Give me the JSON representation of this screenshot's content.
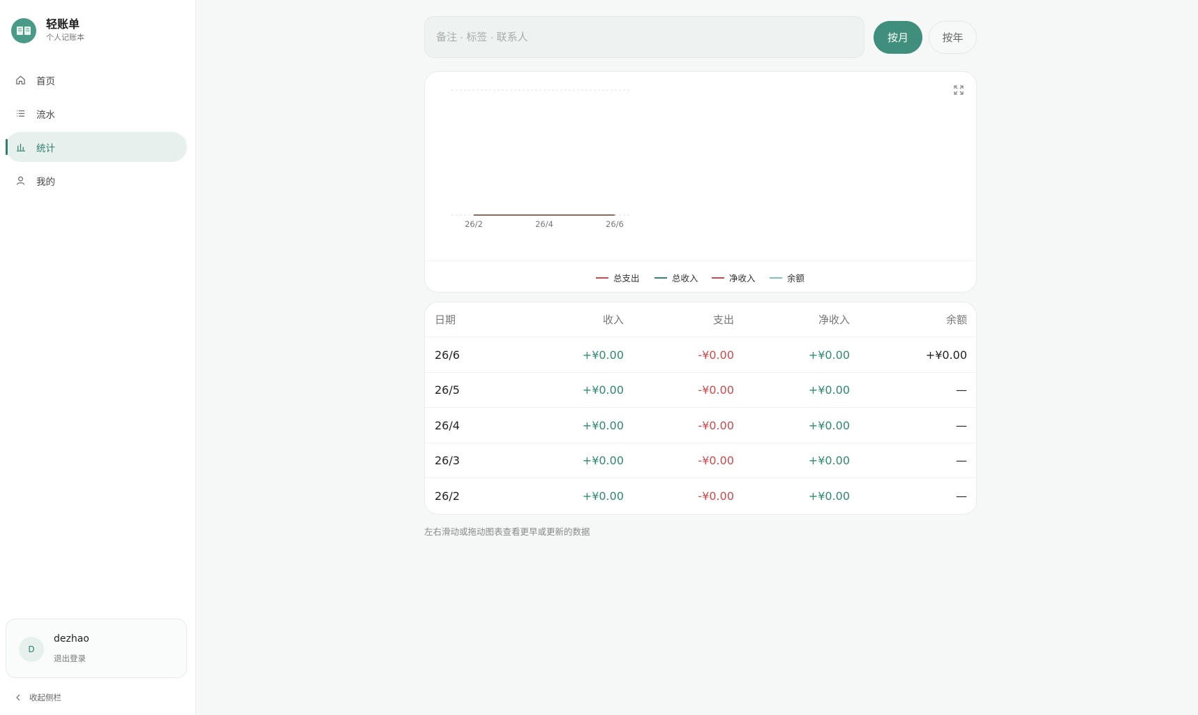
{
  "brand": {
    "title": "轻账单",
    "subtitle": "个人记账本",
    "logo_icon": "book-icon"
  },
  "nav": {
    "items": [
      {
        "label": "首页",
        "icon": "home-icon"
      },
      {
        "label": "流水",
        "icon": "list-icon"
      },
      {
        "label": "统计",
        "icon": "bar-chart-icon",
        "active": true
      },
      {
        "label": "我的",
        "icon": "user-icon"
      }
    ]
  },
  "user": {
    "avatar_letter": "D",
    "name": "dezhao",
    "logout": "退出登录"
  },
  "sidebar_footer": {
    "collapse": "收起侧栏"
  },
  "search": {
    "placeholder": "备注 · 标签 · 联系人",
    "value": ""
  },
  "period": {
    "month_label": "按月",
    "year_label": "按年",
    "selected": "按月"
  },
  "colors": {
    "accent": "#3f8f7c",
    "income": "#2f8a70",
    "expense": "#d4474a",
    "balance_line": "#7fc3ad"
  },
  "chart_data": {
    "type": "line",
    "x": [
      "26/2",
      "26/3",
      "26/4",
      "26/5",
      "26/6"
    ],
    "x_tick_labels": [
      "26/2",
      "26/4",
      "26/6"
    ],
    "series": [
      {
        "name": "总支出",
        "values": [
          0,
          0,
          0,
          0,
          0
        ],
        "color": "#d4474a"
      },
      {
        "name": "总收入",
        "values": [
          0,
          0,
          0,
          0,
          0
        ],
        "color": "#2f8a70"
      },
      {
        "name": "净收入",
        "values": [
          0,
          0,
          0,
          0,
          0
        ],
        "color": "#d4474a"
      },
      {
        "name": "余额",
        "values": [
          null,
          null,
          null,
          null,
          0
        ],
        "color": "#7fc3ad"
      }
    ],
    "grid": "dashed-horizontal",
    "legend_position": "bottom-center"
  },
  "table": {
    "headers": {
      "date": "日期",
      "income": "收入",
      "expense": "支出",
      "net": "净收入",
      "balance": "余额"
    },
    "rows": [
      {
        "date": "26/6",
        "income": "+¥0.00",
        "expense": "-¥0.00",
        "net": "+¥0.00",
        "balance": "+¥0.00"
      },
      {
        "date": "26/5",
        "income": "+¥0.00",
        "expense": "-¥0.00",
        "net": "+¥0.00",
        "balance": "—"
      },
      {
        "date": "26/4",
        "income": "+¥0.00",
        "expense": "-¥0.00",
        "net": "+¥0.00",
        "balance": "—"
      },
      {
        "date": "26/3",
        "income": "+¥0.00",
        "expense": "-¥0.00",
        "net": "+¥0.00",
        "balance": "—"
      },
      {
        "date": "26/2",
        "income": "+¥0.00",
        "expense": "-¥0.00",
        "net": "+¥0.00",
        "balance": "—"
      }
    ]
  },
  "hint": "左右滑动或拖动图表查看更早或更新的数据"
}
